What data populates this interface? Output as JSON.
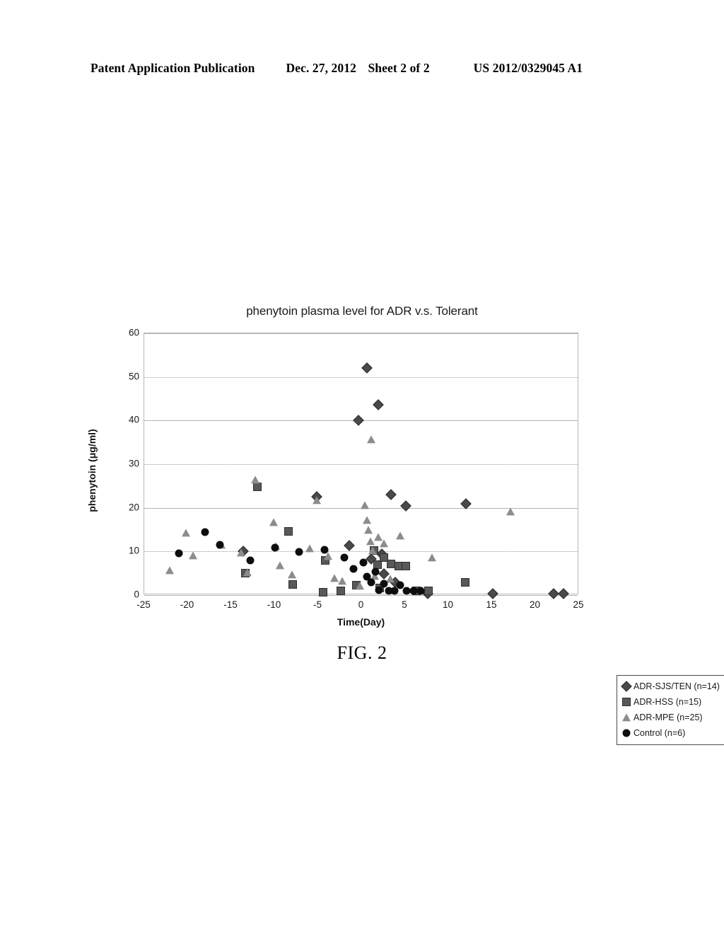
{
  "header": {
    "left": "Patent Application Publication",
    "date": "Dec. 27, 2012",
    "sheet": "Sheet 2 of 2",
    "pub_number": "US 2012/0329045 A1"
  },
  "caption": "FIG. 2",
  "chart_data": {
    "type": "scatter",
    "title": "phenytoin plasma level for ADR v.s. Tolerant",
    "xlabel": "Time(Day)",
    "ylabel": "phenytoin (μg/ml)",
    "xlim": [
      -25,
      25
    ],
    "ylim": [
      0,
      60
    ],
    "xticks": [
      -25,
      -20,
      -15,
      -10,
      -5,
      0,
      5,
      10,
      15,
      20,
      25
    ],
    "yticks": [
      0,
      10,
      20,
      30,
      40,
      50,
      60
    ],
    "grid": "horizontal",
    "legend_position": "top-right",
    "series": [
      {
        "name": "ADR-SJS/TEN (n=14)",
        "marker": "diamond",
        "color": "#4a4a4a",
        "points": [
          [
            -13.6,
            10.1
          ],
          [
            -5.2,
            22.5
          ],
          [
            -1.4,
            11.3
          ],
          [
            -0.4,
            40.0
          ],
          [
            0.6,
            52.0
          ],
          [
            1.1,
            8.3
          ],
          [
            1.9,
            43.7
          ],
          [
            2.3,
            9.4
          ],
          [
            2.6,
            4.9
          ],
          [
            3.4,
            23.0
          ],
          [
            3.9,
            2.9
          ],
          [
            5.1,
            20.4
          ],
          [
            7.6,
            0.4
          ],
          [
            12.0,
            20.9
          ],
          [
            15.1,
            0.3
          ],
          [
            22.1,
            0.3
          ],
          [
            23.2,
            0.3
          ]
        ]
      },
      {
        "name": "ADR-HSS (n=15)",
        "marker": "square",
        "color": "#585858",
        "points": [
          [
            -12.0,
            24.8
          ],
          [
            -13.4,
            5.0
          ],
          [
            -8.4,
            14.6
          ],
          [
            -7.9,
            2.4
          ],
          [
            -4.2,
            7.9
          ],
          [
            -4.4,
            0.7
          ],
          [
            -2.4,
            1.0
          ],
          [
            -0.6,
            2.3
          ],
          [
            1.4,
            10.2
          ],
          [
            1.8,
            6.9
          ],
          [
            2.1,
            1.6
          ],
          [
            2.6,
            8.6
          ],
          [
            3.4,
            7.2
          ],
          [
            4.3,
            6.6
          ],
          [
            5.1,
            6.6
          ],
          [
            6.3,
            0.9
          ],
          [
            7.7,
            0.9
          ],
          [
            11.9,
            2.9
          ]
        ]
      },
      {
        "name": "ADR-MPE (n=25)",
        "marker": "triangle",
        "color": "#8c8c8c",
        "points": [
          [
            -22.1,
            5.5
          ],
          [
            -20.2,
            14.1
          ],
          [
            -19.4,
            9.0
          ],
          [
            -16.1,
            11.4
          ],
          [
            -13.9,
            9.6
          ],
          [
            -13.1,
            5.1
          ],
          [
            -12.2,
            26.3
          ],
          [
            -10.1,
            16.6
          ],
          [
            -9.9,
            11.0
          ],
          [
            -9.4,
            6.7
          ],
          [
            -8.0,
            4.5
          ],
          [
            -6.0,
            10.6
          ],
          [
            -5.2,
            21.5
          ],
          [
            -3.9,
            8.8
          ],
          [
            -3.1,
            3.7
          ],
          [
            -2.2,
            3.1
          ],
          [
            0.4,
            20.4
          ],
          [
            0.6,
            17.0
          ],
          [
            0.8,
            14.7
          ],
          [
            1.0,
            12.2
          ],
          [
            1.3,
            10.0
          ],
          [
            1.5,
            4.2
          ],
          [
            1.9,
            13.1
          ],
          [
            2.6,
            11.6
          ],
          [
            3.3,
            3.5
          ],
          [
            1.1,
            35.5
          ],
          [
            4.4,
            13.4
          ],
          [
            8.1,
            8.4
          ],
          [
            17.1,
            19.0
          ],
          [
            -0.2,
            2.0
          ]
        ]
      },
      {
        "name": "Control (n=6)",
        "marker": "circle",
        "color": "#0d0d0d",
        "points": [
          [
            -21.0,
            9.5
          ],
          [
            -18.0,
            14.5
          ],
          [
            -16.3,
            11.5
          ],
          [
            -12.8,
            8.0
          ],
          [
            -10.0,
            10.9
          ],
          [
            -7.2,
            9.9
          ],
          [
            -4.3,
            10.3
          ],
          [
            -2.0,
            8.6
          ],
          [
            -0.9,
            6.0
          ],
          [
            0.2,
            7.5
          ],
          [
            0.6,
            4.2
          ],
          [
            1.1,
            3.0
          ],
          [
            1.6,
            5.3
          ],
          [
            2.0,
            1.1
          ],
          [
            2.6,
            2.6
          ],
          [
            3.1,
            1.0
          ],
          [
            3.8,
            1.0
          ],
          [
            4.4,
            2.3
          ],
          [
            5.2,
            1.0
          ],
          [
            6.0,
            1.0
          ],
          [
            6.8,
            1.0
          ]
        ]
      }
    ]
  }
}
